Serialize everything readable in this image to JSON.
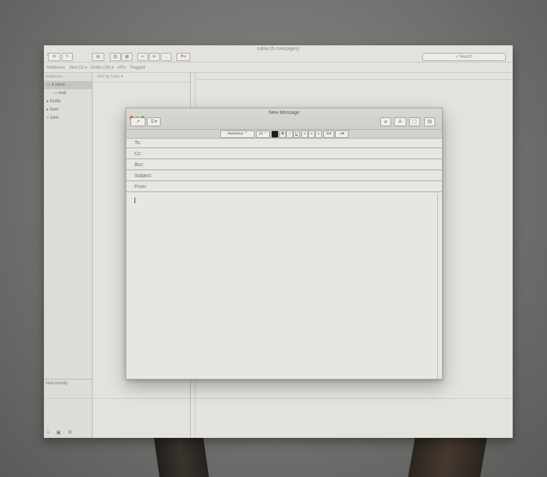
{
  "mail": {
    "window_title": "Inbox (5 messages)",
    "search_placeholder": "Search",
    "favorites": [
      "Mailboxes",
      "Sent (3) ▾",
      "Drafts (16) ▾",
      "VIPs",
      "Flagged"
    ],
    "sort_label": "Sort by Date ▾",
    "sidebar": {
      "heading": "Mailboxes",
      "items": [
        {
          "label": "▾ Inbox",
          "selected": true,
          "icon": "inbox-icon"
        },
        {
          "label": "mail",
          "sub": true,
          "icon": "tray-icon"
        },
        {
          "label": "▸ Drafts",
          "icon": "document-icon"
        },
        {
          "label": "▸ Sent",
          "icon": "paper-plane-icon"
        },
        {
          "label": "Junk",
          "icon": "trash-icon"
        }
      ],
      "activity": "Mail Activity",
      "bottom_icons": "+ ▣ ⚙"
    }
  },
  "compose": {
    "title": "New Message",
    "send_icon": "paper-plane-icon",
    "header_fields_icon": "list-icon",
    "font": "Helvetica",
    "size": "12",
    "color_swatch": "#1a1a1a",
    "bold": "B",
    "italic": "I",
    "underline": "U",
    "fields": [
      "To:",
      "Cc:",
      "Bcc:",
      "Subject:",
      "From:"
    ],
    "traffic": [
      "#e0443a",
      "#e5a92a",
      "#3fb44a"
    ]
  }
}
